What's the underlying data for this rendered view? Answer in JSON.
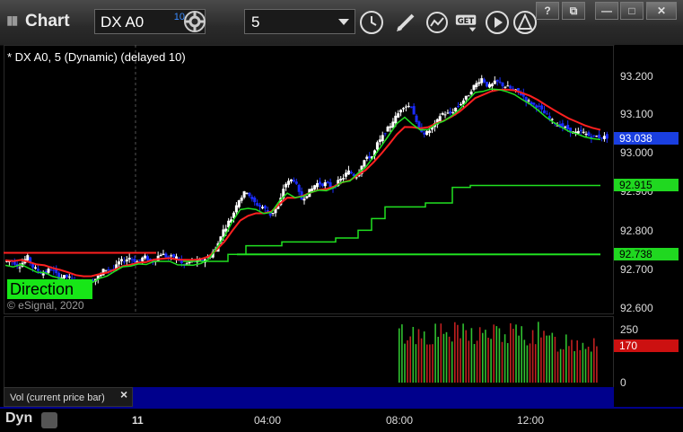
{
  "window": {
    "title": "Chart",
    "symbol": "DX A0",
    "delay_badge": "10",
    "interval": "5"
  },
  "study": {
    "label": "* DX A0, 5 (Dynamic) (delayed 10)",
    "direction_badge": "Direction",
    "copyright": "© eSignal, 2020"
  },
  "price_axis": {
    "ticks": [
      "93.200",
      "93.100",
      "93.000",
      "92.900",
      "92.800",
      "92.700",
      "92.600"
    ],
    "flags": [
      {
        "value": "93.038",
        "bg": "#1a3fe0",
        "fg": "#ffffff"
      },
      {
        "value": "92.915",
        "bg": "#20d820",
        "fg": "#000000"
      },
      {
        "value": "92.738",
        "bg": "#20d820",
        "fg": "#000000"
      }
    ]
  },
  "volume": {
    "label": "Vol (current price bar)",
    "ticks": [
      "250",
      "0"
    ],
    "flag": {
      "value": "170",
      "bg": "#cc1010",
      "fg": "#ffffff"
    }
  },
  "time_axis": {
    "ticks": [
      "11",
      "04:00",
      "08:00",
      "12:00"
    ],
    "mode": "Dyn"
  },
  "colors": {
    "up_candle": "#ffffff",
    "down_candle": "#1a2cff",
    "ma_fast": "#20e020",
    "ma_red": "#ff2020",
    "step_line": "#20e020",
    "vol_up": "#30c030",
    "vol_down": "#c02020"
  },
  "chart_data": {
    "type": "candlestick",
    "ylim": [
      92.6,
      93.25
    ],
    "close_path": [
      92.72,
      92.71,
      92.73,
      92.7,
      92.69,
      92.7,
      92.68,
      92.68,
      92.67,
      92.66,
      92.67,
      92.68,
      92.7,
      92.7,
      92.72,
      92.73,
      92.72,
      92.73,
      92.72,
      92.74,
      92.73,
      92.73,
      92.71,
      92.72,
      92.72,
      92.73,
      92.75,
      92.8,
      92.83,
      92.88,
      92.9,
      92.87,
      92.86,
      92.84,
      92.86,
      92.92,
      92.93,
      92.88,
      92.9,
      92.92,
      92.92,
      92.91,
      92.93,
      92.95,
      92.94,
      92.98,
      92.99,
      93.03,
      93.06,
      93.09,
      93.12,
      93.12,
      93.06,
      93.05,
      93.07,
      93.1,
      93.1,
      93.12,
      93.14,
      93.17,
      93.19,
      93.17,
      93.18,
      93.17,
      93.16,
      93.15,
      93.13,
      93.12,
      93.1,
      93.08,
      93.07,
      93.06,
      93.05,
      93.05,
      93.04,
      93.04,
      93.04
    ]
  }
}
